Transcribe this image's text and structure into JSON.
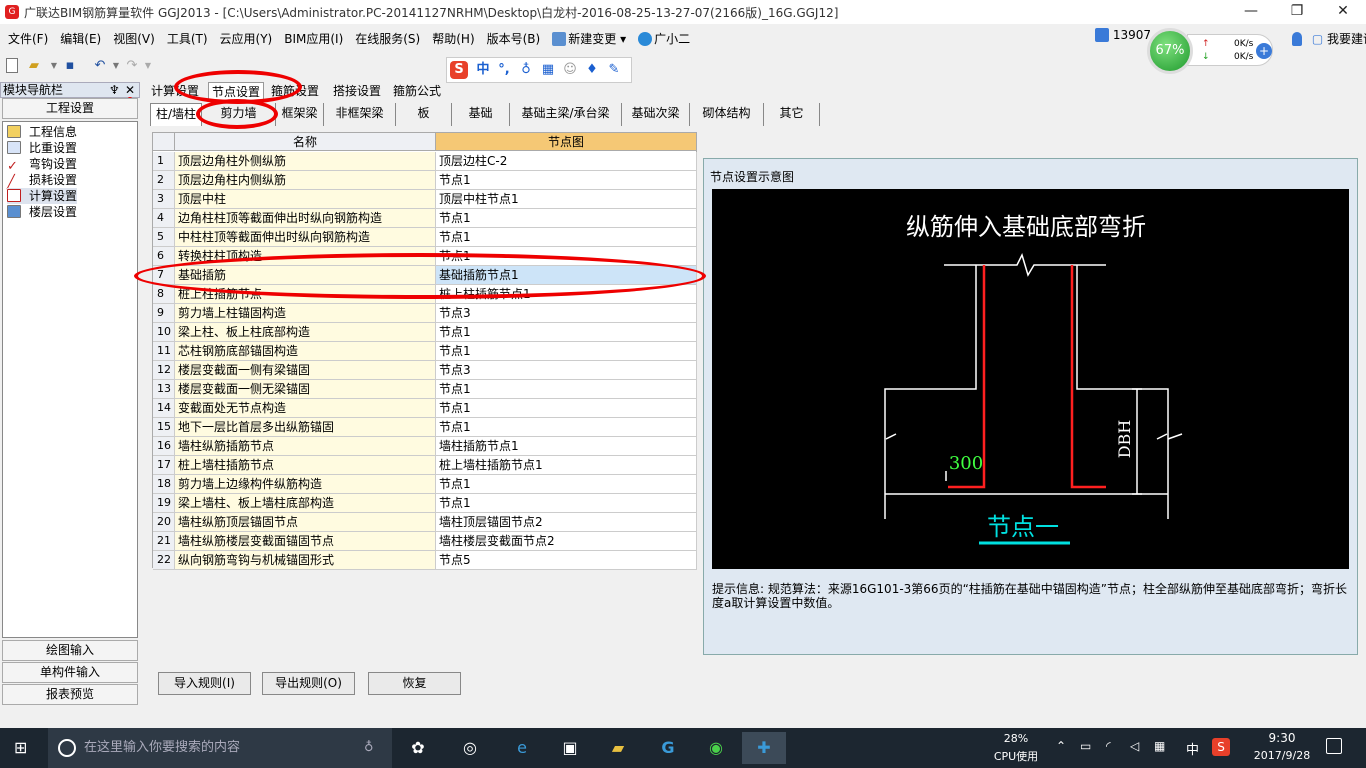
{
  "window": {
    "title": "广联达BIM钢筋算量软件 GGJ2013 - [C:\\Users\\Administrator.PC-20141127NRHM\\Desktop\\白龙村-2016-08-25-13-27-07(2166版)_16G.GGJ12]",
    "min_glyph": "—",
    "max_glyph": "❐",
    "close_glyph": "✕"
  },
  "menu": [
    "文件(F)",
    "编辑(E)",
    "视图(V)",
    "工具(T)",
    "云应用(Y)",
    "BIM应用(I)",
    "在线服务(S)",
    "帮助(H)",
    "版本号(B)",
    "新建变更",
    "广小二"
  ],
  "user": {
    "id": "13907"
  },
  "net": {
    "percent": "67%",
    "up": "0K/s",
    "down": "0K/s"
  },
  "feedback": "我要建议",
  "ime": {
    "logo": "S",
    "lang": "中",
    "punct": "°,"
  },
  "nav": {
    "header": "模块导航栏",
    "pin": "♆",
    "close": "✕",
    "tab": "工程设置",
    "items": [
      "工程信息",
      "比重设置",
      "弯钩设置",
      "损耗设置",
      "计算设置",
      "楼层设置"
    ],
    "bottom": [
      "绘图输入",
      "单构件输入",
      "报表预览"
    ]
  },
  "top_tabs": [
    "计算设置",
    "节点设置",
    "箍筋设置",
    "搭接设置",
    "箍筋公式"
  ],
  "sub_tabs": [
    "柱/墙柱",
    "剪力墙",
    "框架梁",
    "非框架梁",
    "板",
    "基础",
    "基础主梁/承台梁",
    "基础次梁",
    "砌体结构",
    "其它"
  ],
  "grid": {
    "headers": [
      "名称",
      "节点图"
    ],
    "rows": [
      [
        "1",
        "顶层边角柱外侧纵筋",
        "顶层边柱C-2"
      ],
      [
        "2",
        "顶层边角柱内侧纵筋",
        "节点1"
      ],
      [
        "3",
        "顶层中柱",
        "顶层中柱节点1"
      ],
      [
        "4",
        "边角柱柱顶等截面伸出时纵向钢筋构造",
        "节点1"
      ],
      [
        "5",
        "中柱柱顶等截面伸出时纵向钢筋构造",
        "节点1"
      ],
      [
        "6",
        "转换柱柱顶构造",
        "节点1"
      ],
      [
        "7",
        "基础插筋",
        "基础插筋节点1"
      ],
      [
        "8",
        "桩上柱插筋节点",
        "桩上柱插筋节点1"
      ],
      [
        "9",
        "剪力墙上柱锚固构造",
        "节点3"
      ],
      [
        "10",
        "梁上柱、板上柱底部构造",
        "节点1"
      ],
      [
        "11",
        "芯柱钢筋底部锚固构造",
        "节点1"
      ],
      [
        "12",
        "楼层变截面一侧有梁锚固",
        "节点3"
      ],
      [
        "13",
        "楼层变截面一侧无梁锚固",
        "节点1"
      ],
      [
        "14",
        "变截面处无节点构造",
        "节点1"
      ],
      [
        "15",
        "地下一层比首层多出纵筋锚固",
        "节点1"
      ],
      [
        "16",
        "墙柱纵筋插筋节点",
        "墙柱插筋节点1"
      ],
      [
        "17",
        "桩上墙柱插筋节点",
        "桩上墙柱插筋节点1"
      ],
      [
        "18",
        "剪力墙上边缘构件纵筋构造",
        "节点1"
      ],
      [
        "19",
        "梁上墙柱、板上墙柱底部构造",
        "节点1"
      ],
      [
        "20",
        "墙柱纵筋顶层锚固节点",
        "墙柱顶层锚固节点2"
      ],
      [
        "21",
        "墙柱纵筋楼层变截面锚固节点",
        "墙柱楼层变截面节点2"
      ],
      [
        "22",
        "纵向钢筋弯钩与机械锚固形式",
        "节点5"
      ]
    ]
  },
  "diagram": {
    "panel_title": "节点设置示意图",
    "heading": "纵筋伸入基础底部弯折",
    "dim_300": "300",
    "dim_dbh": "DBH",
    "caption": "节点一",
    "hint": "提示信息:  规范算法：来源16G101-3第66页的“柱插筋在基础中锚固构造”节点；柱全部纵筋伸至基础底部弯折；弯折长度a取计算设置中数值。"
  },
  "buttons": [
    "导入规则(I)",
    "导出规则(O)",
    "恢复"
  ],
  "taskbar": {
    "search": "在这里输入你要搜索的内容",
    "cpu_percent": "28%",
    "cpu_label": "CPU使用",
    "lang": "中",
    "time": "9:30",
    "date": "2017/9/28"
  },
  "colors": {
    "diagram_bg": "#000000",
    "rebar": "#ff2020",
    "caption": "#00e0e0",
    "dim_green": "#40ff40",
    "annotation": "#ee0000"
  }
}
